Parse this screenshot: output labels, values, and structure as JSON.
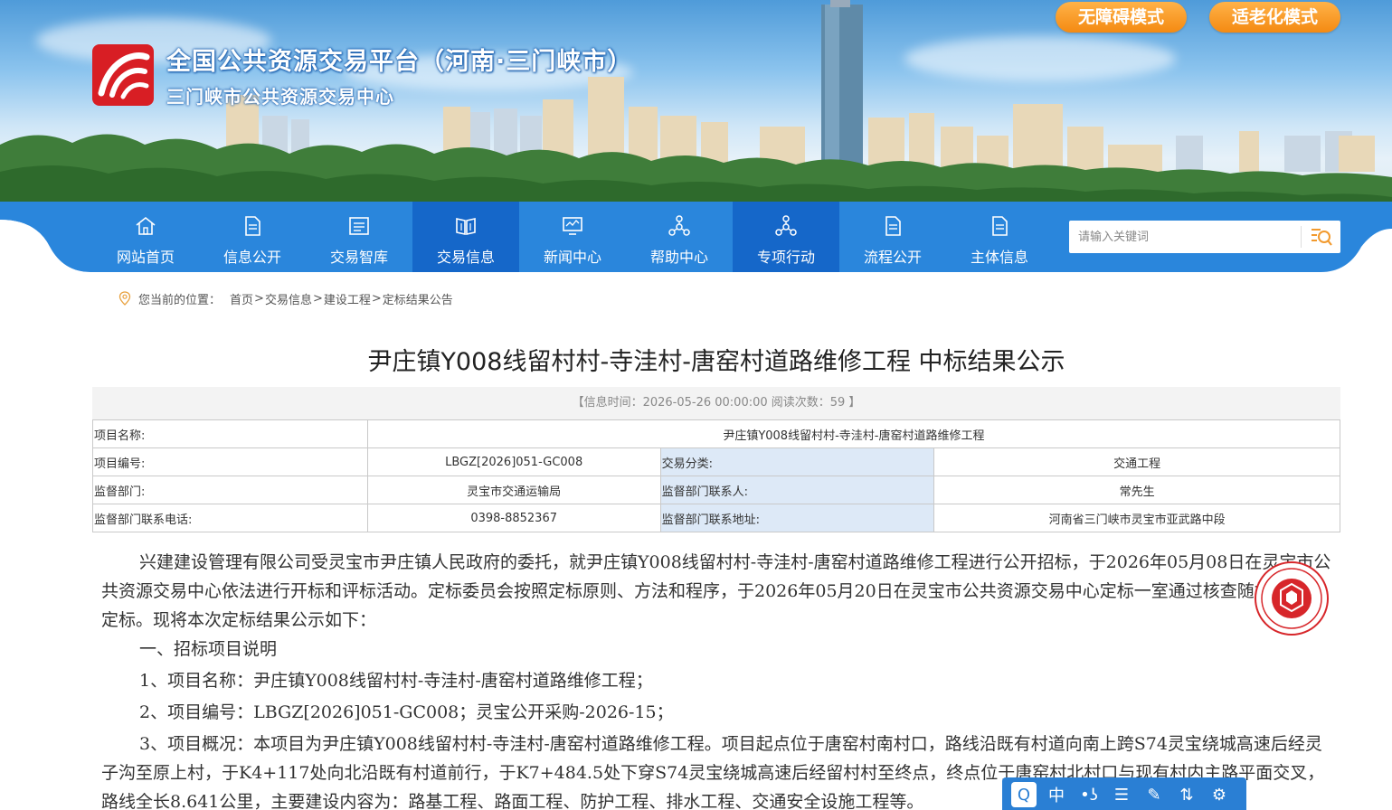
{
  "header": {
    "title_main": "全国公共资源交易平台（河南·三门峡市）",
    "title_sub": "三门峡市公共资源交易中心",
    "accessibility_button": "无障碍模式",
    "elder_button": "适老化模式"
  },
  "nav": {
    "items": [
      {
        "label": "网站首页",
        "icon": "home-icon"
      },
      {
        "label": "信息公开",
        "icon": "document-icon"
      },
      {
        "label": "交易智库",
        "icon": "list-document-icon"
      },
      {
        "label": "交易信息",
        "icon": "book-icon",
        "active": true
      },
      {
        "label": "新闻中心",
        "icon": "monitor-icon"
      },
      {
        "label": "帮助中心",
        "icon": "network-icon"
      },
      {
        "label": "专项行动",
        "icon": "network-icon"
      },
      {
        "label": "流程公开",
        "icon": "document-icon"
      },
      {
        "label": "主体信息",
        "icon": "document-icon"
      }
    ],
    "search_placeholder": "请输入关键词"
  },
  "breadcrumb": {
    "prefix": "您当前的位置：",
    "items": [
      "首页",
      "交易信息",
      "建设工程",
      "定标结果公告"
    ]
  },
  "article": {
    "title": "尹庄镇Y008线留村村-寺洼村-唐窑村道路维修工程 中标结果公示",
    "meta": "【信息时间：2026-05-26 00:00:00    阅读次数：59 】"
  },
  "info_table": {
    "project_name_label": "项目名称:",
    "project_name": "尹庄镇Y008线留村村-寺洼村-唐窑村道路维修工程",
    "project_code_label": "项目编号:",
    "project_code": "LBGZ[2026]051-GC008",
    "category_label": "交易分类:",
    "category": "交通工程",
    "supervisor_label": "监督部门:",
    "supervisor": "灵宝市交通运输局",
    "contact_label": "监督部门联系人:",
    "contact": "常先生",
    "phone_label": "监督部门联系电话:",
    "phone": "0398-8852367",
    "address_label": "监督部门联系地址:",
    "address": "河南省三门峡市灵宝市亚武路中段"
  },
  "body": {
    "p1": "兴建建设管理有限公司受灵宝市尹庄镇人民政府的委托，就尹庄镇Y008线留村村-寺洼村-唐窑村道路维修工程进行公开招标，于2026年05月08日在灵宝市公共资源交易中心依法进行开标和评标活动。定标委员会按照定标原则、方法和程序，于2026年05月20日在灵宝市公共资源交易中心定标一室通过核查随机法进行定标。现将本次定标结果公示如下：",
    "p2": "一、招标项目说明",
    "p3": "1、项目名称：尹庄镇Y008线留村村-寺洼村-唐窑村道路维修工程；",
    "p4": "2、项目编号：LBGZ[2026]051-GC008；灵宝公开采购-2026-15；",
    "p5": "3、项目概况：本项目为尹庄镇Y008线留村村-寺洼村-唐窑村道路维修工程。项目起点位于唐窑村南村口，路线沿既有村道向南上跨S74灵宝绕城高速后经灵子沟至原上村，于K4+117处向北沿既有村道前行，于K7+484.5处下穿S74灵宝绕城高速后经留村村至终点，终点位于唐窑村北村口与现有村内主路平面交叉，路线全长8.641公里，主要建设内容为：路基工程、路面工程、防护工程、排水工程、交通安全设施工程等。"
  },
  "toolbar": {
    "buttons": [
      "Q",
      "中",
      "•ʖ",
      "☰",
      "✎",
      "⇅",
      "⚙"
    ]
  },
  "colors": {
    "nav_blue": "#2a86dc",
    "nav_active": "#1567c9",
    "mode_orange": "#f48a12",
    "label_bg": "#dde9f7"
  }
}
